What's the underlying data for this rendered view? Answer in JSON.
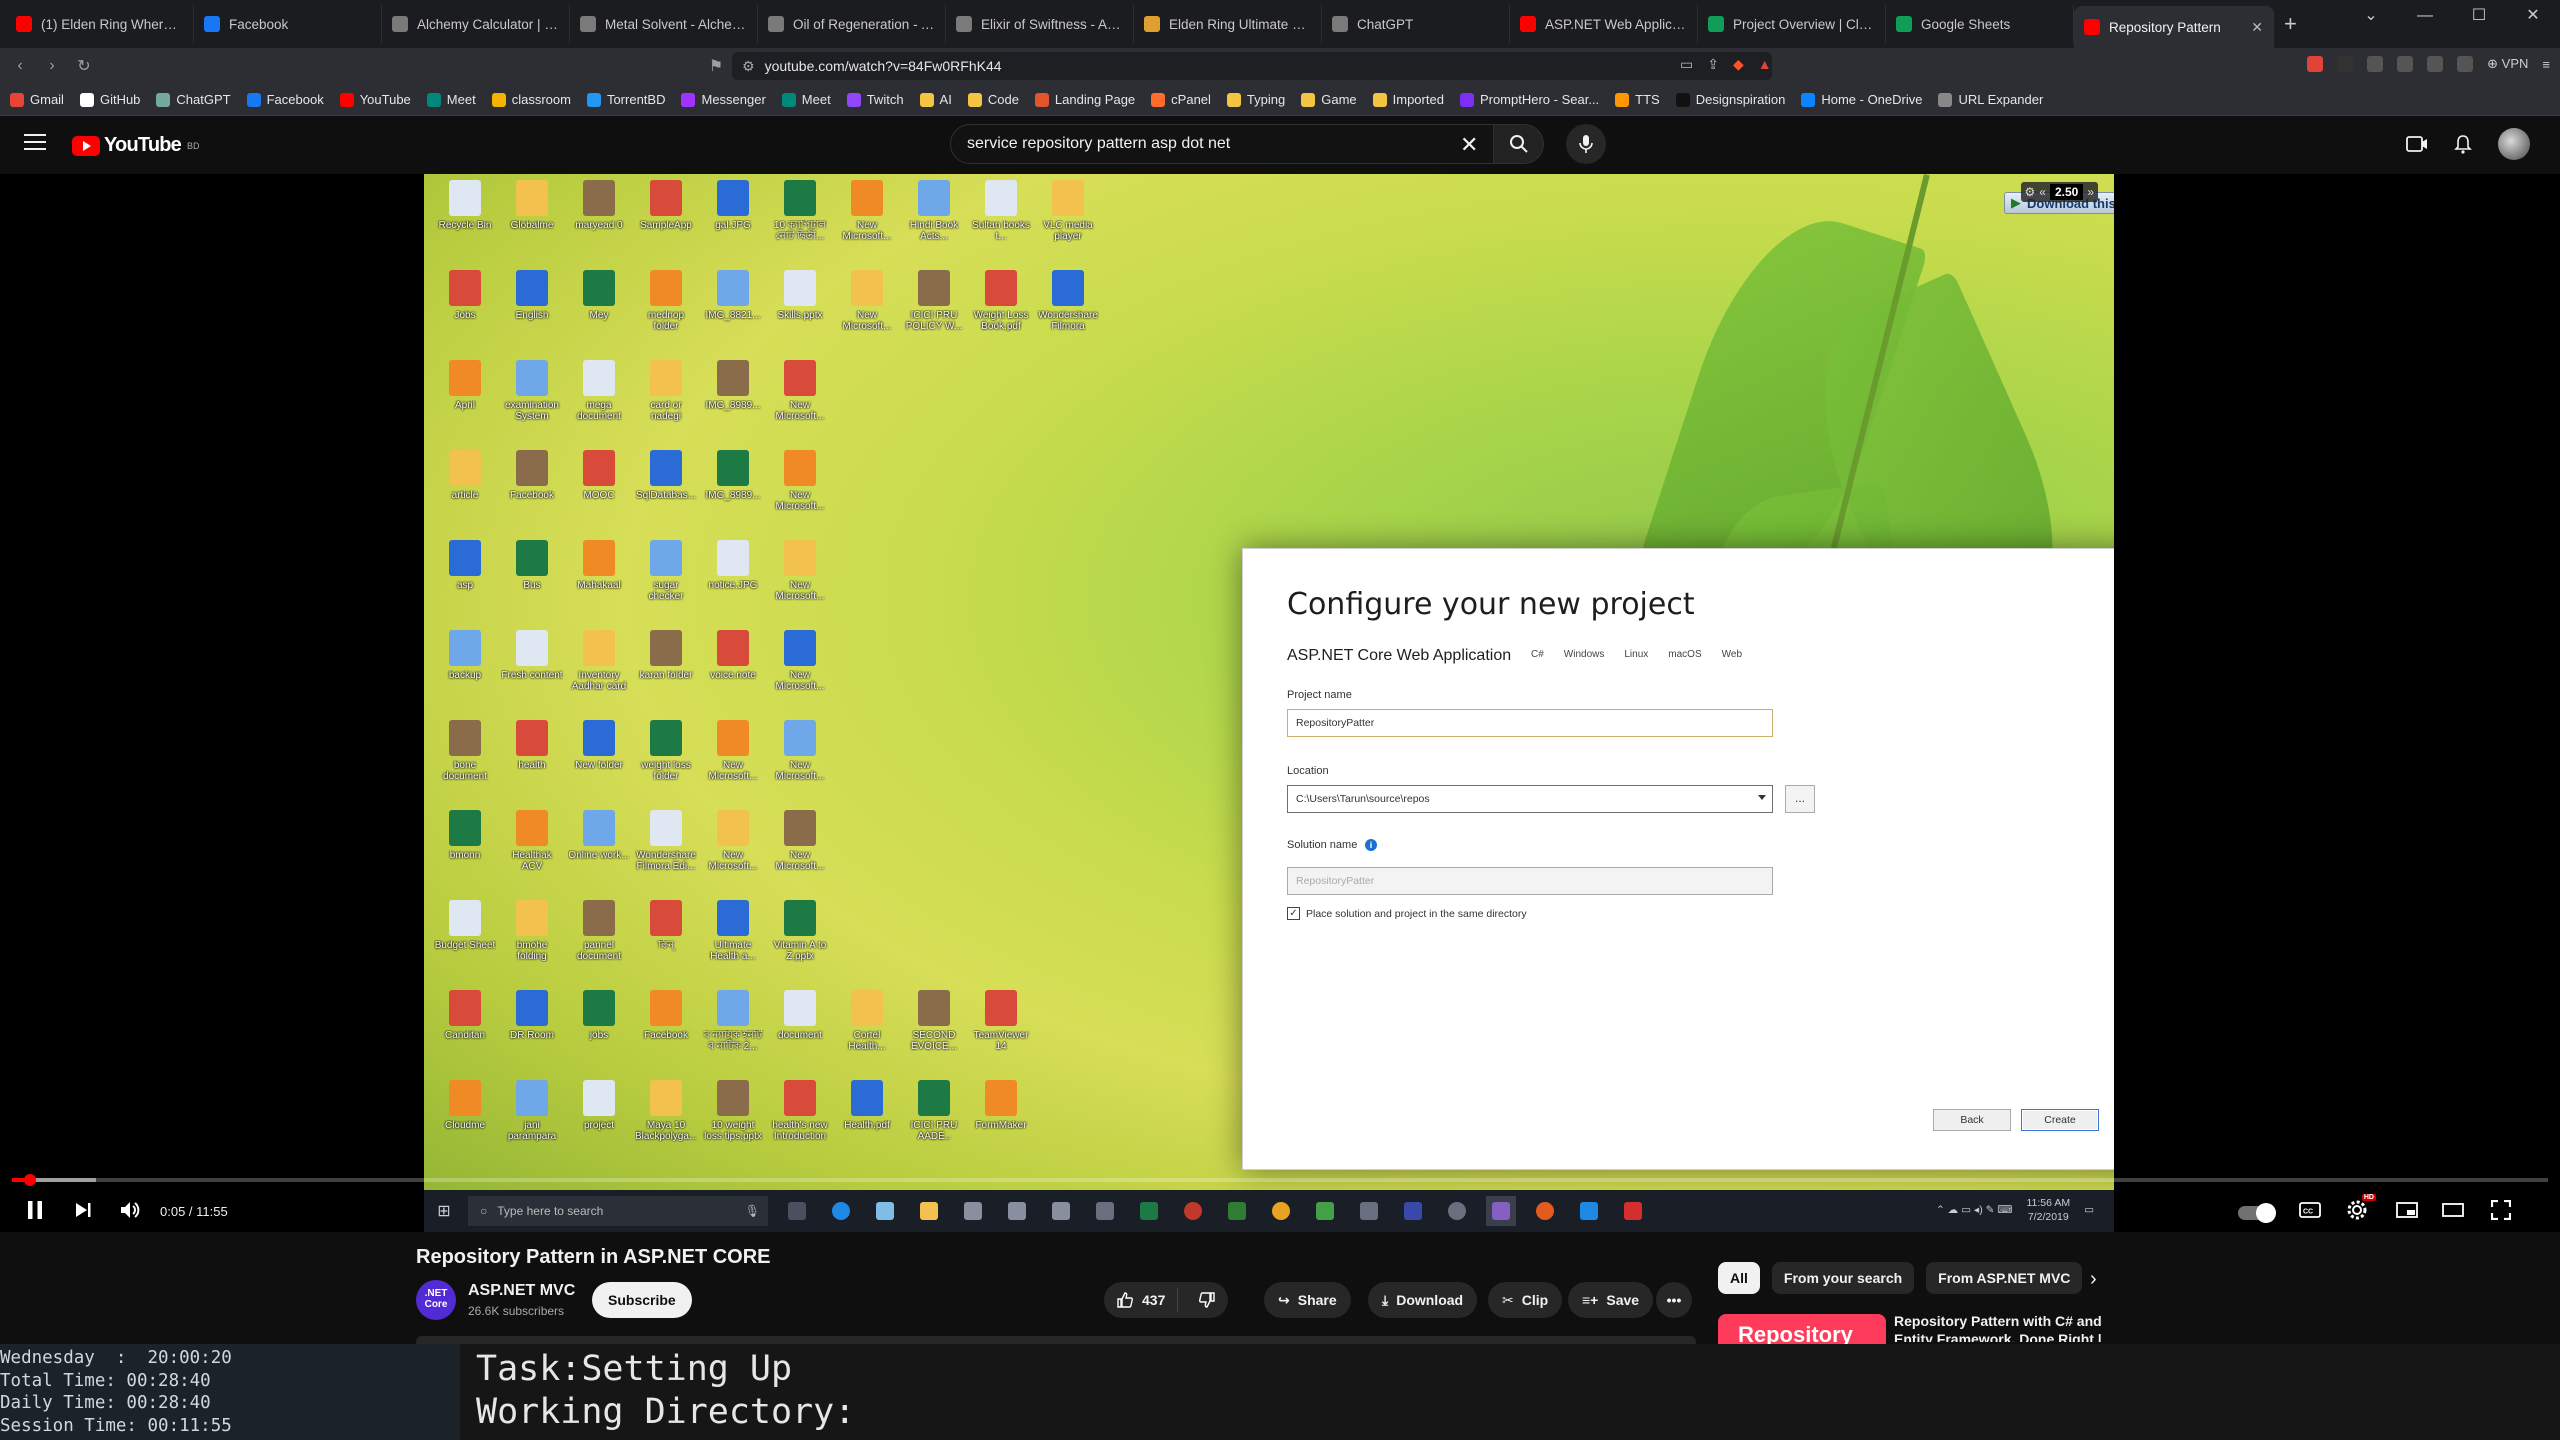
{
  "browser": {
    "tabs": [
      {
        "label": "(1) Elden Ring Where To G",
        "fav_color": "#ff0000"
      },
      {
        "label": "Facebook",
        "fav_color": "#1877f2"
      },
      {
        "label": "Alchemy Calculator | bdoly",
        "fav_color": "#7a7a7a"
      },
      {
        "label": "Metal Solvent - Alchemy C",
        "fav_color": "#7a7a7a"
      },
      {
        "label": "Oil of Regeneration - Alch",
        "fav_color": "#7a7a7a"
      },
      {
        "label": "Elixir of Swiftness - Alchem",
        "fav_color": "#7a7a7a"
      },
      {
        "label": "Elden Ring Ultimate Cheat",
        "fav_color": "#e0a030"
      },
      {
        "label": "ChatGPT",
        "fav_color": "#7a7a7a"
      },
      {
        "label": "ASP.NET Web Application",
        "fav_color": "#ff0000"
      },
      {
        "label": "Project Overview | Cloud",
        "fav_color": "#0f9d58"
      },
      {
        "label": "Google Sheets",
        "fav_color": "#0f9d58"
      },
      {
        "label": "Repository Pattern",
        "fav_color": "#ff0000",
        "active": true
      }
    ],
    "new_tab": "+",
    "url": "youtube.com/watch?v=84Fw0RFhK44",
    "vpn_label": "VPN",
    "bookmarks": [
      {
        "label": "Gmail",
        "color": "#ea4335"
      },
      {
        "label": "GitHub",
        "color": "#ffffff"
      },
      {
        "label": "ChatGPT",
        "color": "#74aa9c"
      },
      {
        "label": "Facebook",
        "color": "#1877f2"
      },
      {
        "label": "YouTube",
        "color": "#ff0000"
      },
      {
        "label": "Meet",
        "color": "#00897b"
      },
      {
        "label": "classroom",
        "color": "#f4b400"
      },
      {
        "label": "TorrentBD",
        "color": "#2196f3"
      },
      {
        "label": "Messenger",
        "color": "#a033ff"
      },
      {
        "label": "Meet",
        "color": "#00897b"
      },
      {
        "label": "Twitch",
        "color": "#9146ff"
      },
      {
        "label": "AI",
        "color": "#f4c542"
      },
      {
        "label": "Code",
        "color": "#f4c542"
      },
      {
        "label": "Landing Page",
        "color": "#e0552b"
      },
      {
        "label": "cPanel",
        "color": "#ff6c2c"
      },
      {
        "label": "Typing",
        "color": "#f4c542"
      },
      {
        "label": "Game",
        "color": "#f4c542"
      },
      {
        "label": "Imported",
        "color": "#f4c542"
      },
      {
        "label": "PromptHero - Sear...",
        "color": "#7b2ff7"
      },
      {
        "label": "TTS",
        "color": "#ff9800"
      },
      {
        "label": "Designspiration",
        "color": "#111111"
      },
      {
        "label": "Home - OneDrive",
        "color": "#0a84ff"
      },
      {
        "label": "URL Expander",
        "color": "#888888"
      }
    ]
  },
  "youtube": {
    "logo_text": "YouTube",
    "logo_region": "BD",
    "search_query": "service repository pattern asp dot net",
    "player": {
      "download_overlay": "Download this video",
      "speed": "2.50",
      "time": "0:05 / 11:55",
      "progress_played": 0.007,
      "progress_loaded": 0.033
    },
    "video_title": "Repository Pattern in ASP.NET CORE",
    "channel": {
      "avatar_text": ".NET Core",
      "name": "ASP.NET MVC",
      "subscribers": "26.6K subscribers",
      "subscribe_label": "Subscribe"
    },
    "actions": {
      "likes": "437",
      "share": "Share",
      "download": "Download",
      "clip": "Clip",
      "save": "Save"
    },
    "filters": [
      "All",
      "From your search",
      "From ASP.NET MVC"
    ],
    "recommendation": {
      "thumb_text": "Repository",
      "title": "Repository Pattern with C# and Entity Framework, Done Right |"
    }
  },
  "vs_dialog": {
    "title": "Configure your new project",
    "template": "ASP.NET Core Web Application",
    "tags": [
      "C#",
      "Windows",
      "Linux",
      "macOS",
      "Web"
    ],
    "project_name_label": "Project name",
    "project_name_value": "RepositoryPatter",
    "location_label": "Location",
    "location_value": "C:\\Users\\Tarun\\source\\repos",
    "browse_label": "...",
    "solution_name_label": "Solution name",
    "solution_name_value": "RepositoryPatter",
    "same_dir_label": "Place solution and project in the same directory",
    "back_label": "Back",
    "create_label": "Create"
  },
  "desktop_icons": [
    [
      "Recycle Bin",
      "Globalme",
      "maryead 0",
      "SampleApp",
      "gal.JPG",
      "10 ক্যাপিটাল নোট দ্বিতী...",
      "New Microsoft...",
      "Hindi Book Acts...",
      "Sultan books t...",
      "VLC media player"
    ],
    [
      "Jobs",
      "English",
      "Mey",
      "mednop folder",
      "IMG_8821...",
      "Skills.pptx",
      "New Microsoft...",
      "ICICI PRU POLICY W...",
      "Weight Loss Book.pdf",
      "Wondershare Filmora"
    ],
    [
      "April",
      "examination System",
      "mega document",
      "card or nadegi",
      "IMG_8989...",
      "New Microsoft..."
    ],
    [
      "article",
      "Facebook",
      "MOOC",
      "SqlDatabas...",
      "IMG_8989...",
      "New Microsoft..."
    ],
    [
      "asp",
      "Bus",
      "Mahakaal",
      "sugar checker",
      "notice.JPG",
      "New Microsoft..."
    ],
    [
      "backup",
      "Fresh content",
      "Inventory Aadhar card",
      "karan folder",
      "voice.note",
      "New Microsoft..."
    ],
    [
      "bone document",
      "health",
      "New folder",
      "weight loss folder",
      "New Microsoft...",
      "New Microsoft..."
    ],
    [
      "bmonn",
      "Healthak ACV",
      "Online work...",
      "Wondershare Filmora Edi...",
      "New Microsoft...",
      "New Microsoft..."
    ],
    [
      "Budget Sheet",
      "bmohe folding",
      "pannel document",
      "ক্বিন্",
      "Ultimate Health a...",
      "Vitamin A to Z.pptx"
    ],
    [
      "Canditan",
      "DR Room",
      "jobs",
      "Facebook",
      "ব ন্যায়িক ইনটি ব নাটিক 2...",
      "document",
      "Cortel Health...",
      "SECOND EVOICE...",
      "TeamViewer 14"
    ],
    [
      "Cloudme",
      "jani parampara",
      "project",
      "Maya 10 Blackpolyga...",
      "10 weight loss tips.pptx",
      "health's new Introduction",
      "Health.pdf",
      "ICICI PRU AADE..",
      "FormMaker"
    ]
  ],
  "windows_taskbar": {
    "search_placeholder": "Type here to search",
    "time": "11:56 AM",
    "date": "7/2/2019"
  },
  "tracker": {
    "stats": [
      "Wednesday  :  20:00:20",
      "Total Time: 00:28:40",
      "Daily Time: 00:28:40",
      "Session Time: 00:11:55"
    ],
    "task_line": "Task:Setting Up",
    "dir_line": "Working Directory:"
  }
}
